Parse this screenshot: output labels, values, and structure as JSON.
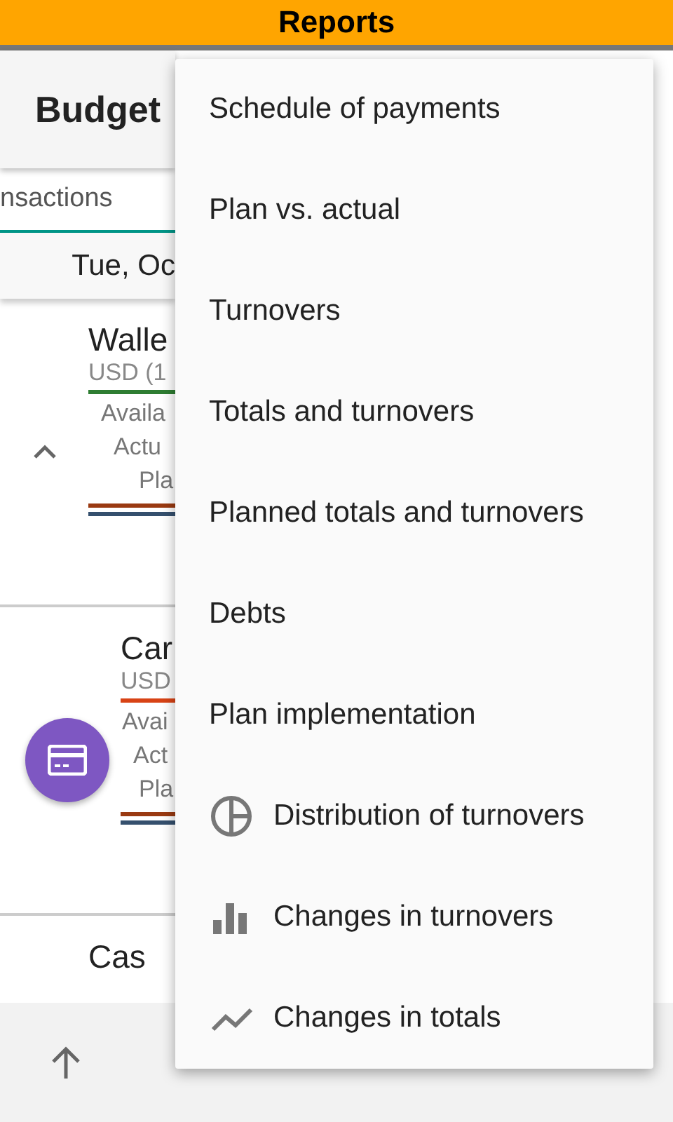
{
  "status_bar": {
    "title": "Reports"
  },
  "header": {
    "title": "Budget"
  },
  "tab": {
    "label": "nsactions",
    "selected": true
  },
  "date": "Tue, Oc",
  "accounts": [
    {
      "name": "Walle",
      "currency": "USD (1",
      "color": "#2e7d32",
      "lines": [
        "Availa",
        "Actu",
        "Pla"
      ],
      "expanded": true
    },
    {
      "name": "Car",
      "currency": "USD",
      "color": "#d84315",
      "lines": [
        "Avai",
        "Act",
        "Pla"
      ],
      "kind": "card"
    },
    {
      "name": "Cas"
    }
  ],
  "menu": [
    {
      "label": "Schedule of payments"
    },
    {
      "label": "Plan vs. actual"
    },
    {
      "label": "Turnovers"
    },
    {
      "label": "Totals and turnovers"
    },
    {
      "label": "Planned totals and turnovers"
    },
    {
      "label": "Debts"
    },
    {
      "label": "Plan implementation"
    },
    {
      "label": "Distribution of turnovers",
      "kind": "pie"
    },
    {
      "label": "Changes in turnovers",
      "kind": "bar"
    },
    {
      "label": "Changes in totals",
      "kind": "line"
    }
  ]
}
